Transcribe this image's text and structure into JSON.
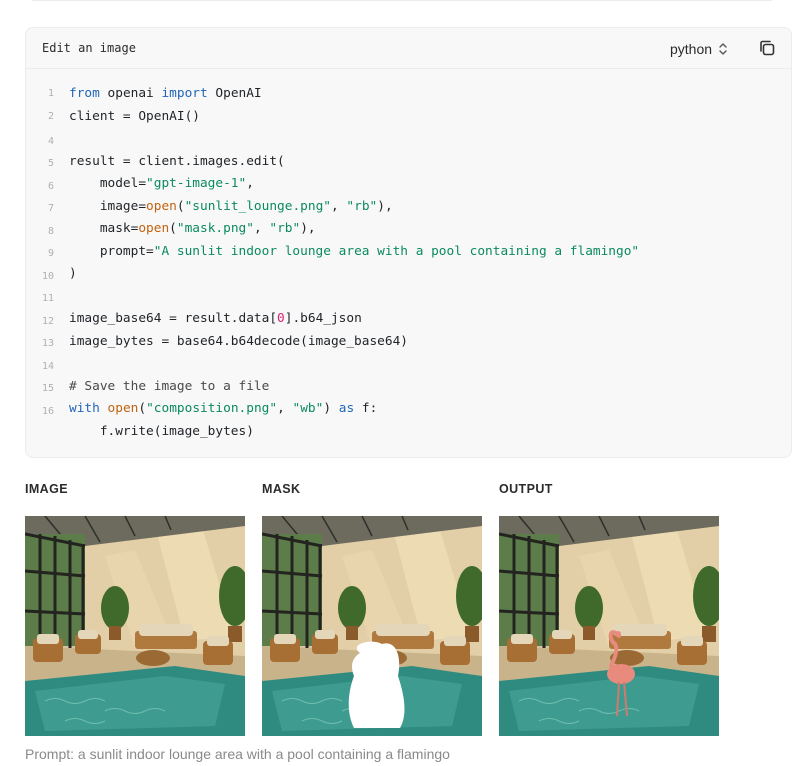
{
  "code_card": {
    "title": "Edit an image",
    "language": "python",
    "line_numbers": [
      "1",
      "2",
      "3",
      "4",
      "5",
      "6",
      "7",
      "8",
      "9",
      "10",
      "11",
      "12",
      "13",
      "14",
      "15",
      "16"
    ]
  },
  "columns": {
    "image": "IMAGE",
    "mask": "MASK",
    "output": "OUTPUT"
  },
  "caption": "Prompt: a sunlit indoor lounge area with a pool containing a flamingo",
  "colors": {
    "keyword": "#2166b8",
    "builtin": "#c2620f",
    "string": "#0b8a61",
    "number": "#d4246d",
    "card_bg": "#f8f8f8"
  },
  "icons": {
    "language_toggle": "chevron-up-down-icon",
    "copy": "copy-icon"
  }
}
